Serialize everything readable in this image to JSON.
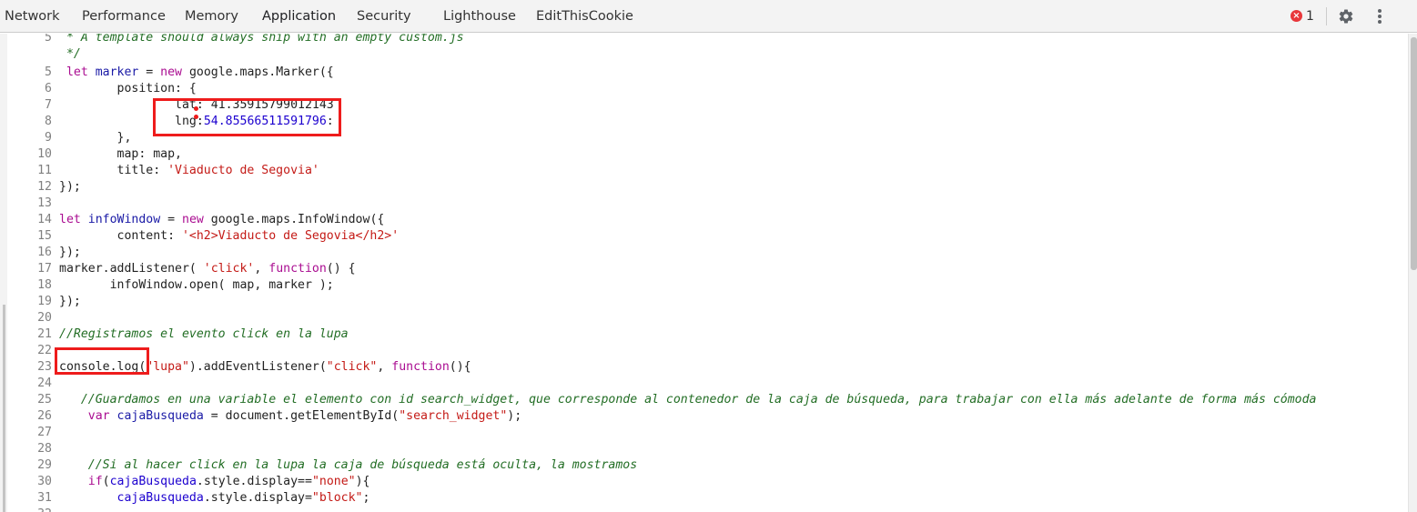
{
  "tabs": [
    {
      "label": "Network",
      "selected": false
    },
    {
      "label": "Performance",
      "selected": false
    },
    {
      "label": "Memory",
      "selected": false
    },
    {
      "label": "Application",
      "selected": true
    },
    {
      "label": "Security",
      "selected": false
    },
    {
      "label": "Lighthouse",
      "selected": false
    },
    {
      "label": "EditThisCookie",
      "selected": false
    }
  ],
  "toolbar": {
    "error_icon": "error-x-icon",
    "error_count": "1",
    "settings_icon": "gear-icon",
    "menu_icon": "more-vertical-icon"
  },
  "colors": {
    "keyword": "#aa0d91",
    "string": "#c41a16",
    "comment": "#236e25",
    "variable": "#1c00cf",
    "annotation": "#ee1c1c"
  },
  "code_lines": [
    {
      "num": "5",
      "indent": "",
      "tokens": [
        {
          "t": " * A template should always ship with an empty custom.js",
          "c": "comment"
        }
      ]
    },
    {
      "num": "",
      "indent": "",
      "tokens": [
        {
          "t": " */",
          "c": "comment"
        }
      ]
    },
    {
      "num": "5",
      "indent": "",
      "tokens": [
        {
          "t": " let ",
          "c": "keyword"
        },
        {
          "t": "marker",
          "c": "def"
        },
        {
          "t": " = ",
          "c": "plain"
        },
        {
          "t": "new",
          "c": "keyword"
        },
        {
          "t": " google.maps.Marker({",
          "c": "plain"
        }
      ]
    },
    {
      "num": "6",
      "indent": "",
      "tokens": [
        {
          "t": "        position: {",
          "c": "plain"
        }
      ]
    },
    {
      "num": "7",
      "indent": "",
      "tokens": [
        {
          "t": "                lat: 41.35915799012143",
          "c": "plain"
        }
      ]
    },
    {
      "num": "8",
      "indent": "",
      "tokens": [
        {
          "t": "                lng",
          "c": "plain"
        },
        {
          "t": ":",
          "c": "plain"
        },
        {
          "t": "54.85566511591796",
          "c": "number"
        },
        {
          "t": ":",
          "c": "plain"
        }
      ]
    },
    {
      "num": "9",
      "indent": "",
      "tokens": [
        {
          "t": "        },",
          "c": "plain"
        }
      ]
    },
    {
      "num": "10",
      "indent": "",
      "tokens": [
        {
          "t": "        map: map,",
          "c": "plain"
        }
      ]
    },
    {
      "num": "11",
      "indent": "",
      "tokens": [
        {
          "t": "        title: ",
          "c": "plain"
        },
        {
          "t": "'Viaducto de Segovia'",
          "c": "string"
        }
      ]
    },
    {
      "num": "12",
      "indent": "",
      "tokens": [
        {
          "t": "});",
          "c": "plain"
        }
      ]
    },
    {
      "num": "13",
      "indent": "",
      "tokens": [
        {
          "t": "",
          "c": "plain"
        }
      ]
    },
    {
      "num": "14",
      "indent": "",
      "tokens": [
        {
          "t": "let ",
          "c": "keyword"
        },
        {
          "t": "infoWindow",
          "c": "def"
        },
        {
          "t": " = ",
          "c": "plain"
        },
        {
          "t": "new",
          "c": "keyword"
        },
        {
          "t": " google.maps.InfoWindow({",
          "c": "plain"
        }
      ]
    },
    {
      "num": "15",
      "indent": "",
      "tokens": [
        {
          "t": "        content: ",
          "c": "plain"
        },
        {
          "t": "'<h2>Viaducto de Segovia</h2>'",
          "c": "string"
        }
      ]
    },
    {
      "num": "16",
      "indent": "",
      "tokens": [
        {
          "t": "});",
          "c": "plain"
        }
      ]
    },
    {
      "num": "17",
      "indent": "",
      "tokens": [
        {
          "t": "marker.addListener( ",
          "c": "plain"
        },
        {
          "t": "'click'",
          "c": "string"
        },
        {
          "t": ", ",
          "c": "plain"
        },
        {
          "t": "function",
          "c": "keyword"
        },
        {
          "t": "() {",
          "c": "plain"
        }
      ]
    },
    {
      "num": "18",
      "indent": "",
      "tokens": [
        {
          "t": "       infoWindow.open( map, marker );",
          "c": "plain"
        }
      ]
    },
    {
      "num": "19",
      "indent": "",
      "tokens": [
        {
          "t": "});",
          "c": "plain"
        }
      ]
    },
    {
      "num": "20",
      "indent": "",
      "tokens": [
        {
          "t": "",
          "c": "plain"
        }
      ]
    },
    {
      "num": "21",
      "indent": "",
      "tokens": [
        {
          "t": "//Registramos el evento click en la lupa",
          "c": "comment"
        }
      ]
    },
    {
      "num": "22",
      "indent": "",
      "tokens": [
        {
          "t": "",
          "c": "plain"
        }
      ]
    },
    {
      "num": "23",
      "indent": "",
      "tokens": [
        {
          "t": "console.log(",
          "c": "plain"
        },
        {
          "t": "\"lupa\"",
          "c": "string"
        },
        {
          "t": ").addEventListener(",
          "c": "plain"
        },
        {
          "t": "\"click\"",
          "c": "string"
        },
        {
          "t": ", ",
          "c": "plain"
        },
        {
          "t": "function",
          "c": "keyword"
        },
        {
          "t": "(){",
          "c": "plain"
        }
      ]
    },
    {
      "num": "24",
      "indent": "",
      "tokens": [
        {
          "t": "",
          "c": "plain"
        }
      ]
    },
    {
      "num": "25",
      "indent": "",
      "tokens": [
        {
          "t": "   //Guardamos en una variable el elemento con id search_widget, que corresponde al contenedor de la caja de búsqueda, para trabajar con ella más adelante de forma más cómoda",
          "c": "comment"
        }
      ]
    },
    {
      "num": "26",
      "indent": "",
      "tokens": [
        {
          "t": "    ",
          "c": "plain"
        },
        {
          "t": "var",
          "c": "keyword"
        },
        {
          "t": " ",
          "c": "plain"
        },
        {
          "t": "cajaBusqueda",
          "c": "def"
        },
        {
          "t": " = document.getElementById(",
          "c": "plain"
        },
        {
          "t": "\"search_widget\"",
          "c": "string"
        },
        {
          "t": ");",
          "c": "plain"
        }
      ]
    },
    {
      "num": "27",
      "indent": "",
      "tokens": [
        {
          "t": "",
          "c": "plain"
        }
      ]
    },
    {
      "num": "28",
      "indent": "",
      "tokens": [
        {
          "t": "",
          "c": "plain"
        }
      ]
    },
    {
      "num": "29",
      "indent": "",
      "tokens": [
        {
          "t": "    //Si al hacer click en la lupa la caja de búsqueda está oculta, la mostramos",
          "c": "comment"
        }
      ]
    },
    {
      "num": "30",
      "indent": "",
      "tokens": [
        {
          "t": "    ",
          "c": "plain"
        },
        {
          "t": "if",
          "c": "keyword"
        },
        {
          "t": "(",
          "c": "plain"
        },
        {
          "t": "cajaBusqueda",
          "c": "variable"
        },
        {
          "t": ".style.display==",
          "c": "plain"
        },
        {
          "t": "\"none\"",
          "c": "string"
        },
        {
          "t": "){",
          "c": "plain"
        }
      ]
    },
    {
      "num": "31",
      "indent": "",
      "tokens": [
        {
          "t": "        ",
          "c": "plain"
        },
        {
          "t": "cajaBusqueda",
          "c": "variable"
        },
        {
          "t": ".style.display=",
          "c": "plain"
        },
        {
          "t": "\"block\"",
          "c": "string"
        },
        {
          "t": ";",
          "c": "plain"
        }
      ]
    },
    {
      "num": "32",
      "indent": "",
      "tokens": [
        {
          "t": "",
          "c": "plain"
        }
      ]
    }
  ]
}
